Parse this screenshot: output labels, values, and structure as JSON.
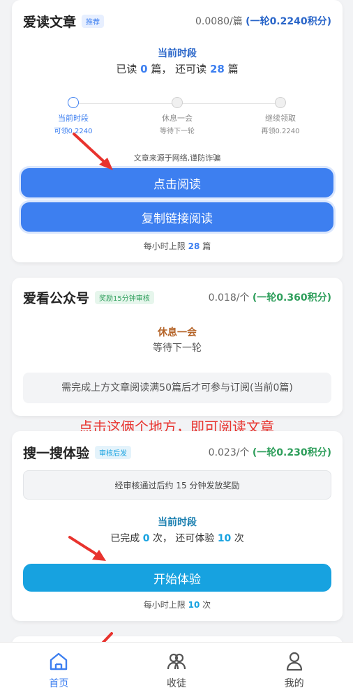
{
  "card1": {
    "title": "爱读文章",
    "tag": "推荐",
    "price": "0.0080/篇",
    "price_round": "(一轮0.2240积分)",
    "period_title": "当前时段",
    "read_prefix": "已读",
    "read_count": "0",
    "read_mid": "篇， 还可读",
    "remain_count": "28",
    "read_suffix": "篇",
    "steps": [
      {
        "label": "当前时段",
        "sub": "可领0.2240"
      },
      {
        "label": "休息一会",
        "sub": "等待下一轮"
      },
      {
        "label": "继续领取",
        "sub": "再领0.2240"
      }
    ],
    "notice": "文章来源于网络,谨防诈骗",
    "btn_read": "点击阅读",
    "btn_copy": "复制链接阅读",
    "limit_prefix": "每小时上限",
    "limit_value": "28",
    "limit_suffix": "篇"
  },
  "card2": {
    "title": "爱看公众号",
    "tag": "奖励15分钟审核",
    "price": "0.018/个",
    "price_round": "(一轮0.360积分)",
    "status_title": "休息一会",
    "status_sub": "等待下一轮",
    "requirement": "需完成上方文章阅读满50篇后才可参与订阅(当前0篇)"
  },
  "annotation": "点击这俩个地方，即可阅读文章",
  "card3": {
    "title": "搜一搜体验",
    "tag": "审核后发",
    "price": "0.023/个",
    "price_round": "(一轮0.230积分)",
    "review_note": "经审核通过后约 15 分钟发放奖励",
    "period_title": "当前时段",
    "done_prefix": "已完成",
    "done_count": "0",
    "done_mid": "次， 还可体验",
    "remain_count": "10",
    "done_suffix": "次",
    "btn_start": "开始体验",
    "limit_prefix": "每小时上限",
    "limit_value": "10",
    "limit_suffix": "次"
  },
  "tabbar": {
    "items": [
      {
        "label": "首页",
        "icon": "home-icon"
      },
      {
        "label": "收徒",
        "icon": "users-icon"
      },
      {
        "label": "我的",
        "icon": "user-icon"
      }
    ]
  },
  "colors": {
    "primary_blue": "#3d7ff0",
    "teal_blue": "#17a2e0",
    "green": "#2e9e5b",
    "orange": "#b5652a",
    "annotation_red": "#e8332e",
    "title_blue": "#2a66c9"
  }
}
